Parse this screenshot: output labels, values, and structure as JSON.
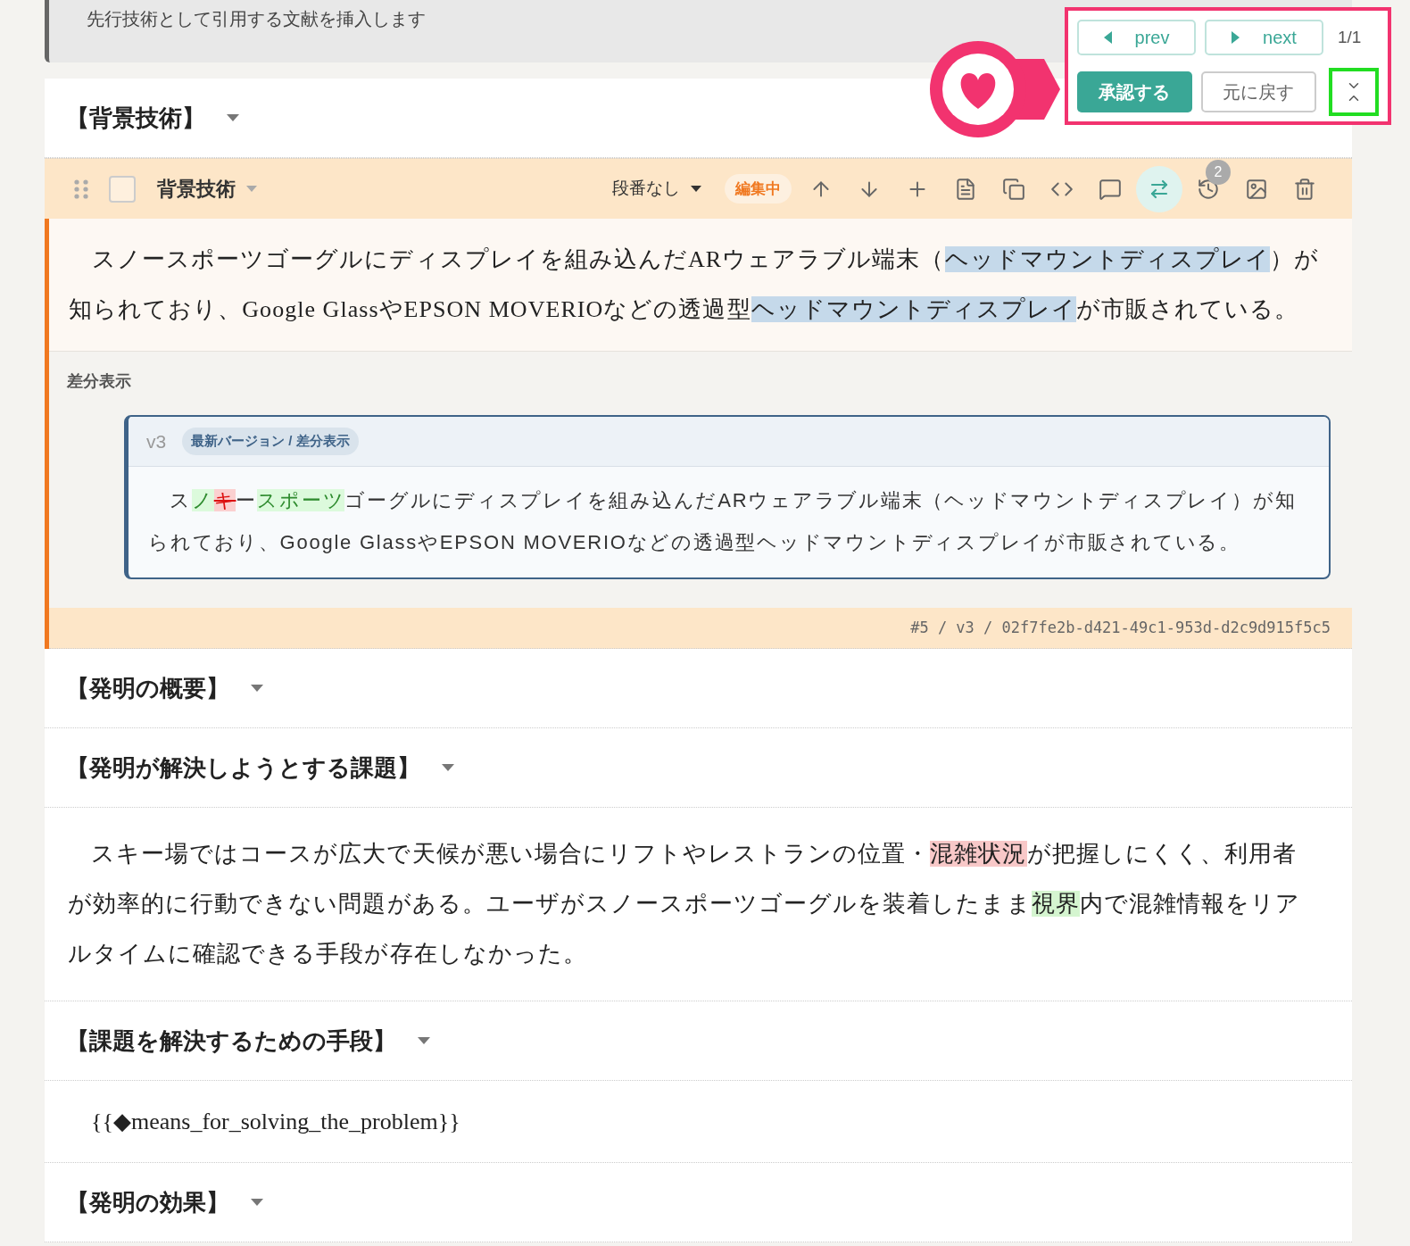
{
  "hint": "先行技術として引用する文献を挿入します",
  "review_panel": {
    "prev": "prev",
    "next": "next",
    "count": "1/1",
    "approve": "承認する",
    "revert": "元に戻す",
    "collapse_selected": true
  },
  "sections": [
    {
      "kind": "heading",
      "title": "【背景技術】"
    },
    {
      "kind": "block",
      "title": "背景技術",
      "checked": false,
      "numbering": "段番なし",
      "status": "編集中",
      "history_count": "2",
      "compare_active": true,
      "paragraph": [
        {
          "kind": "plain",
          "text": "スノースポーツゴーグルにディスプレイを組み込んだARウェアラブル端末（"
        },
        {
          "kind": "term",
          "text": "ヘッドマウントディスプレイ"
        },
        {
          "kind": "plain",
          "text": "）が知られており、Google GlassやEPSON MOVERIOなどの透過型"
        },
        {
          "kind": "term",
          "text": "ヘッドマウントディスプレイ"
        },
        {
          "kind": "plain",
          "text": "が市販されている。"
        }
      ],
      "diff_label": "差分表示",
      "diff_version": "v3",
      "diff_badge": "最新バージョン / 差分表示",
      "diff": [
        {
          "kind": "same",
          "text": "ス"
        },
        {
          "kind": "added",
          "text": "ノ"
        },
        {
          "kind": "removed",
          "text": "キ"
        },
        {
          "kind": "same",
          "text": "ー"
        },
        {
          "kind": "added",
          "text": "スポーツ"
        },
        {
          "kind": "same",
          "text": "ゴーグルにディスプレイを組み込んだARウェアラブル端末（ヘッドマウントディスプレイ）が知られており、Google GlassやEPSON MOVERIOなどの透過型ヘッドマウントディスプレイが市販されている。"
        }
      ],
      "footer": "#5 / v3 / 02f7fe2b-d421-49c1-953d-d2c9d915f5c5"
    },
    {
      "kind": "heading",
      "title": "【発明の概要】"
    },
    {
      "kind": "heading",
      "title": "【発明が解決しようとする課題】"
    },
    {
      "kind": "paragraph",
      "segments": [
        {
          "kind": "plain",
          "text": "スキー場ではコースが広大で天候が悪い場合にリフトやレストランの位置・"
        },
        {
          "kind": "removed",
          "text": "混雑状況"
        },
        {
          "kind": "plain",
          "text": "が把握しにくく、利用者が効率的に行動できない問題がある。ユーザがスノースポーツゴーグルを装着したまま"
        },
        {
          "kind": "added",
          "text": "視界"
        },
        {
          "kind": "plain",
          "text": "内で混雑情報をリアルタイムに確認できる手段が存在しなかった。"
        }
      ]
    },
    {
      "kind": "heading",
      "title": "【課題を解決するための手段】"
    },
    {
      "kind": "placeholder",
      "text": "{{◆means_for_solving_the_problem}}"
    },
    {
      "kind": "heading",
      "title": "【発明の効果】"
    }
  ]
}
